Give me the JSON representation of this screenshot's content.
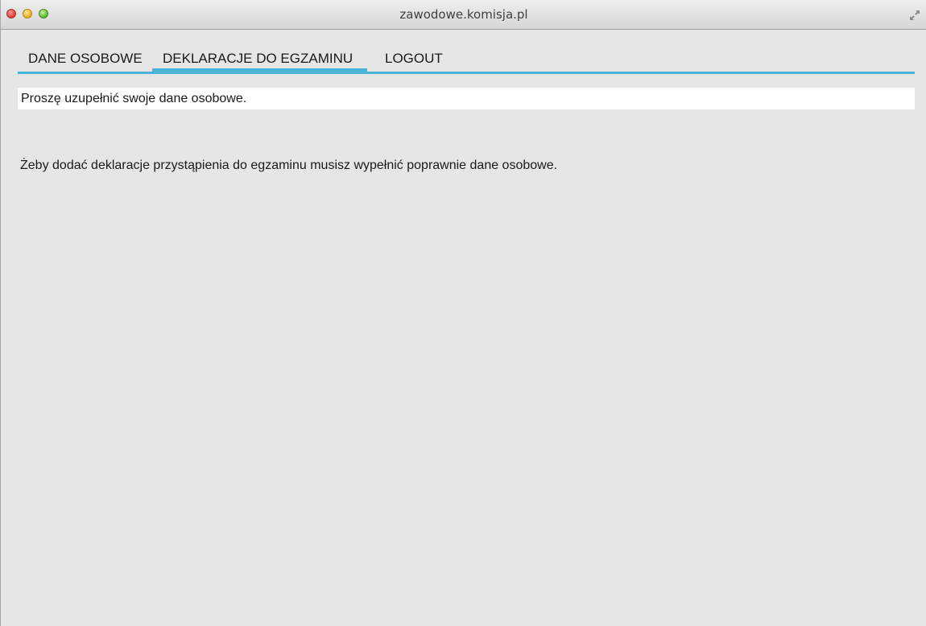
{
  "window": {
    "title": "zawodowe.komisja.pl"
  },
  "tabs": [
    {
      "label": "DANE OSOBOWE",
      "active": false
    },
    {
      "label": "DEKLARACJE DO EGZAMINU",
      "active": true
    },
    {
      "label": "LOGOUT",
      "active": false
    }
  ],
  "notice": {
    "text": "Proszę uzupełnić swoje dane osobowe."
  },
  "main": {
    "message": "Żeby dodać deklaracje przystąpienia do egzaminu musisz wypełnić poprawnie dane osobowe."
  },
  "colors": {
    "accent": "#4ab3d8",
    "background": "#e6e6e6",
    "notice_background": "#ffffff"
  },
  "icons": {
    "close": "close-traffic-light-icon",
    "minimize": "minimize-traffic-light-icon",
    "zoom": "zoom-traffic-light-icon",
    "fullscreen": "fullscreen-arrows-icon"
  }
}
